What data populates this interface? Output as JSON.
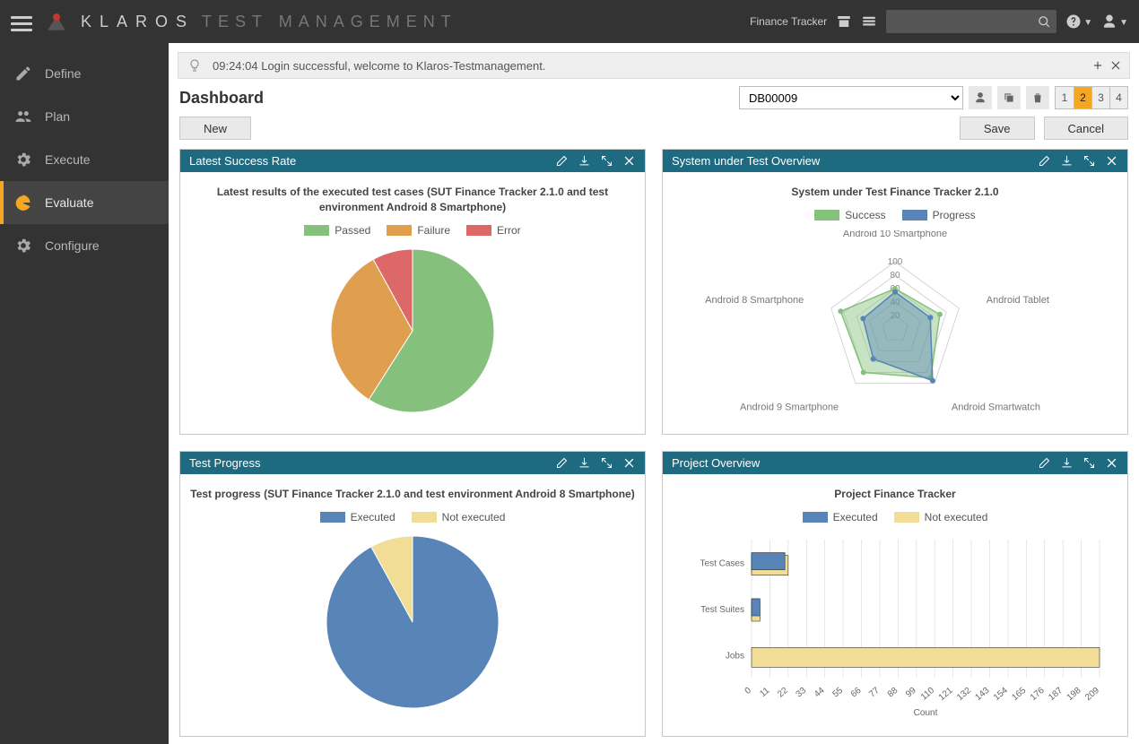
{
  "header": {
    "app_name": "KLAROS",
    "app_subtitle": "TEST MANAGEMENT",
    "context_label": "Finance Tracker",
    "search_placeholder": ""
  },
  "sidebar": {
    "items": [
      {
        "key": "define",
        "label": "Define",
        "active": false
      },
      {
        "key": "plan",
        "label": "Plan",
        "active": false
      },
      {
        "key": "execute",
        "label": "Execute",
        "active": false
      },
      {
        "key": "evaluate",
        "label": "Evaluate",
        "active": true
      },
      {
        "key": "configure",
        "label": "Configure",
        "active": false
      }
    ]
  },
  "notice": {
    "text": "09:24:04 Login successful, welcome to Klaros-Testmanagement."
  },
  "dashboard": {
    "title": "Dashboard",
    "selected_db": "DB00009",
    "pages": [
      "1",
      "2",
      "3",
      "4"
    ],
    "active_page": "2",
    "buttons": {
      "new": "New",
      "save": "Save",
      "cancel": "Cancel"
    }
  },
  "panels": {
    "success_rate": {
      "title": "Latest Success Rate",
      "chart_title": "Latest results of the executed test cases (SUT Finance Tracker 2.1.0 and test environment Android 8 Smartphone)",
      "legend": [
        "Passed",
        "Failure",
        "Error"
      ],
      "colors": [
        "#85c17d",
        "#e09f4f",
        "#dc6868"
      ]
    },
    "sut_overview": {
      "title": "System under Test Overview",
      "chart_title": "System under Test Finance Tracker 2.1.0",
      "legend": [
        "Success",
        "Progress"
      ],
      "colors": [
        "#85c17d",
        "#5884b8"
      ]
    },
    "test_progress": {
      "title": "Test Progress",
      "chart_title": "Test progress (SUT Finance Tracker 2.1.0 and test environment Android 8 Smartphone)",
      "legend": [
        "Executed",
        "Not executed"
      ],
      "colors": [
        "#5884b8",
        "#f2dd96"
      ]
    },
    "project_overview": {
      "title": "Project Overview",
      "chart_title": "Project Finance Tracker",
      "legend": [
        "Executed",
        "Not executed"
      ],
      "colors": [
        "#5884b8",
        "#f2dd96"
      ],
      "xlabel": "Count"
    }
  },
  "chart_data": [
    {
      "id": "success_rate",
      "type": "pie",
      "title": "Latest results of the executed test cases (SUT Finance Tracker 2.1.0 and test environment Android 8 Smartphone)",
      "series": [
        {
          "name": "Passed",
          "value": 59
        },
        {
          "name": "Failure",
          "value": 33
        },
        {
          "name": "Error",
          "value": 8
        }
      ]
    },
    {
      "id": "sut_overview",
      "type": "radar",
      "title": "System under Test Finance Tracker 2.1.0",
      "axes": [
        "Android 10 Smartphone",
        "Android Tablet",
        "Android Smartwatch",
        "Android 9 Smartphone",
        "Android 8 Smartphone"
      ],
      "ticks": [
        20,
        40,
        60,
        80,
        100
      ],
      "series": [
        {
          "name": "Success",
          "values": [
            60,
            70,
            90,
            80,
            85
          ]
        },
        {
          "name": "Progress",
          "values": [
            55,
            55,
            95,
            55,
            50
          ]
        }
      ]
    },
    {
      "id": "test_progress",
      "type": "pie",
      "title": "Test progress (SUT Finance Tracker 2.1.0 and test environment Android 8 Smartphone)",
      "series": [
        {
          "name": "Executed",
          "value": 92
        },
        {
          "name": "Not executed",
          "value": 8
        }
      ]
    },
    {
      "id": "project_overview",
      "type": "bar",
      "orientation": "horizontal",
      "title": "Project Finance Tracker",
      "xlabel": "Count",
      "xlim": [
        0,
        209
      ],
      "xticks": [
        0,
        11,
        22,
        33,
        44,
        55,
        66,
        77,
        88,
        99,
        110,
        121,
        132,
        143,
        154,
        165,
        176,
        187,
        198,
        209
      ],
      "categories": [
        "Test Cases",
        "Test Suites",
        "Jobs"
      ],
      "series": [
        {
          "name": "Executed",
          "values": [
            20,
            5,
            0
          ]
        },
        {
          "name": "Not executed",
          "values": [
            22,
            5,
            209
          ]
        }
      ]
    }
  ]
}
